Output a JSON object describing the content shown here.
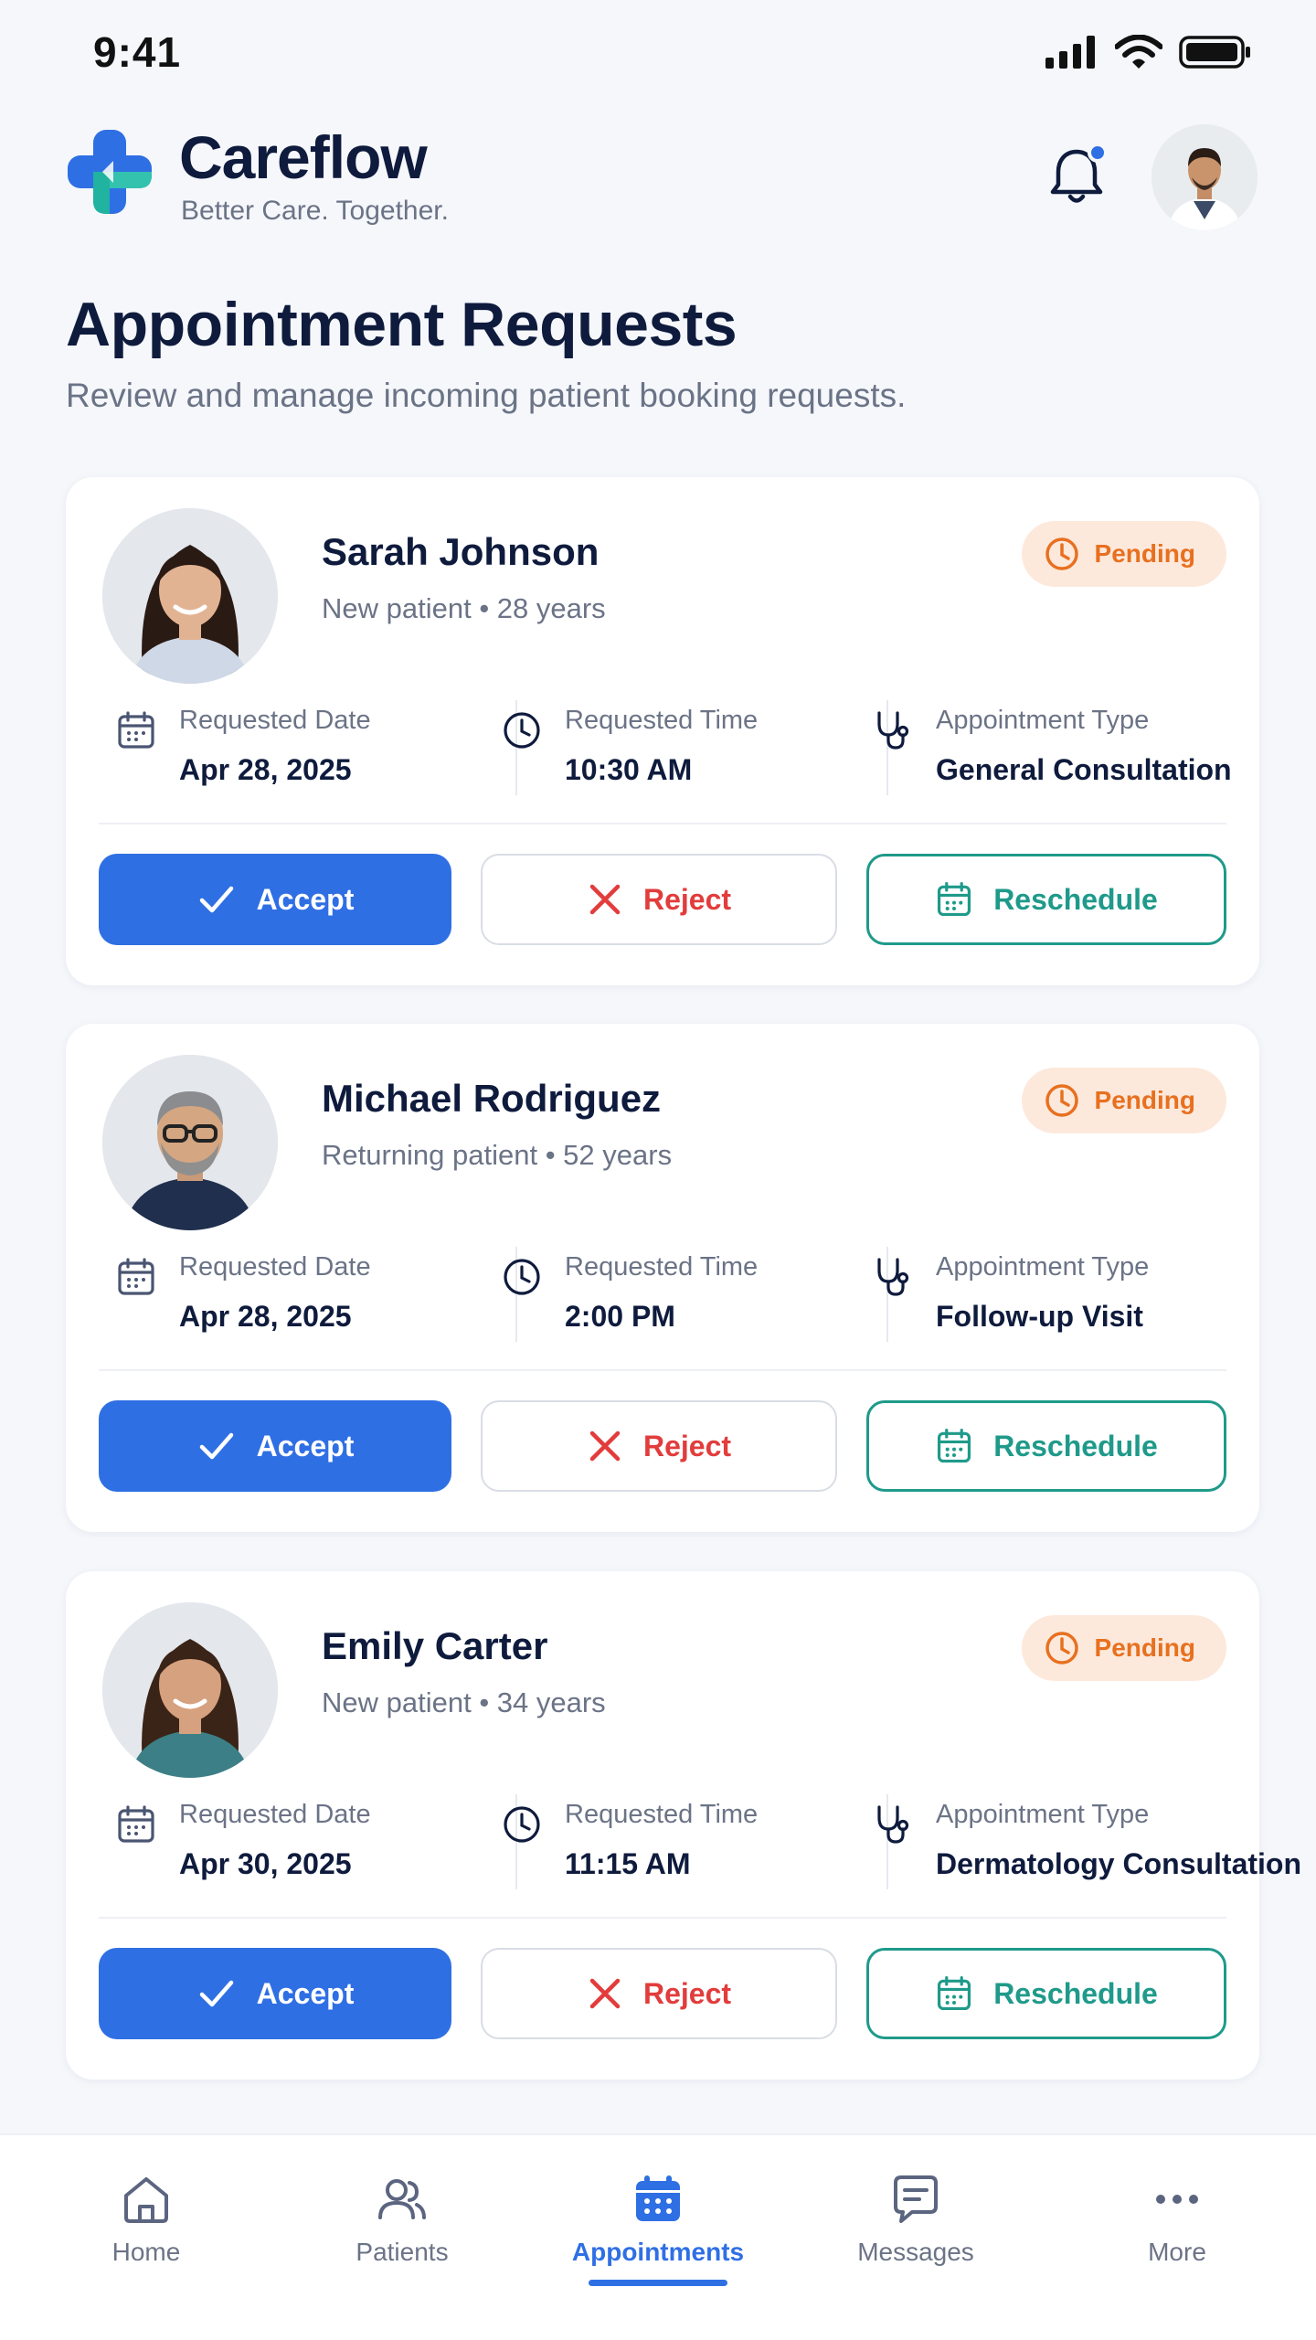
{
  "status_bar": {
    "time": "9:41"
  },
  "brand": {
    "name": "Careflow",
    "tagline": "Better Care. Together."
  },
  "page": {
    "title": "Appointment Requests",
    "subtitle": "Review and manage incoming patient booking requests."
  },
  "labels": {
    "date": "Requested Date",
    "time": "Requested Time",
    "type": "Appointment Type",
    "accept": "Accept",
    "reject": "Reject",
    "reschedule": "Reschedule"
  },
  "requests": [
    {
      "name": "Sarah Johnson",
      "meta": "New patient • 28 years",
      "status": "Pending",
      "date": "Apr 28, 2025",
      "time": "10:30 AM",
      "type": "General Consultation",
      "avatar": "woman-avatar"
    },
    {
      "name": "Michael Rodriguez",
      "meta": "Returning patient • 52 years",
      "status": "Pending",
      "date": "Apr 28, 2025",
      "time": "2:00 PM",
      "type": "Follow-up Visit",
      "avatar": "man-avatar"
    },
    {
      "name": "Emily Carter",
      "meta": "New patient • 34 years",
      "status": "Pending",
      "date": "Apr 30, 2025",
      "time": "11:15 AM",
      "type": "Dermatology Consultation",
      "avatar": "woman-avatar"
    }
  ],
  "nav": {
    "items": [
      {
        "label": "Home",
        "icon": "home-icon"
      },
      {
        "label": "Patients",
        "icon": "patients-icon"
      },
      {
        "label": "Appointments",
        "icon": "calendar-icon",
        "active": true
      },
      {
        "label": "Messages",
        "icon": "message-icon"
      },
      {
        "label": "More",
        "icon": "more-icon"
      }
    ]
  },
  "colors": {
    "primary": "#2f6fe4",
    "teal": "#1f9a8a",
    "danger": "#e23c3c",
    "pending": "#e8701f",
    "pending_bg": "#fde9dc"
  }
}
